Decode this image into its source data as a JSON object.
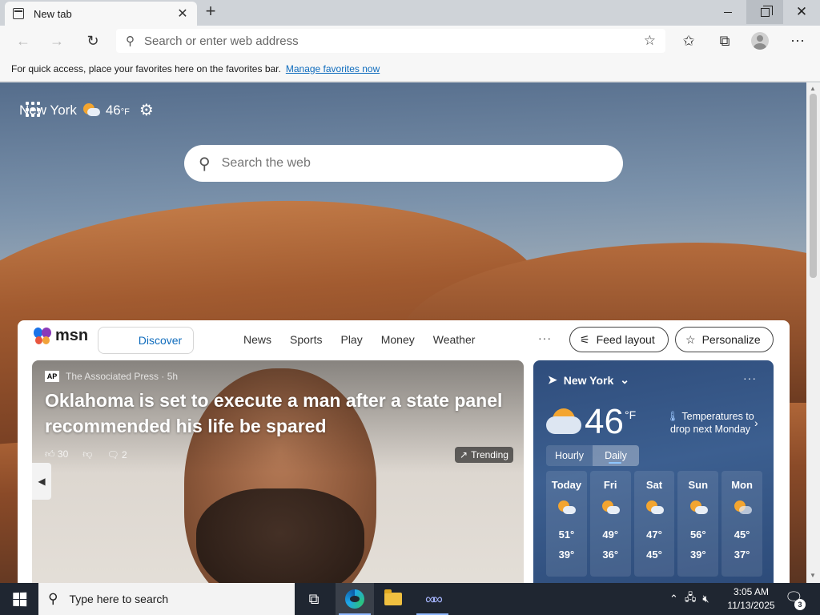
{
  "browser": {
    "tab_title": "New tab",
    "address_placeholder": "Search or enter web address",
    "favorites_bar_text": "For quick access, place your favorites here on the favorites bar.",
    "favorites_bar_link": "Manage favorites now"
  },
  "newtab": {
    "location": "New York",
    "temperature": "46",
    "temp_unit": "°F",
    "search_placeholder": "Search the web"
  },
  "feed": {
    "logo_text": "msn",
    "discover_label": "Discover",
    "nav": [
      "News",
      "Sports",
      "Play",
      "Money",
      "Weather"
    ],
    "more_label": "···",
    "feed_layout_label": "Feed layout",
    "personalize_label": "Personalize"
  },
  "story": {
    "source_badge": "AP",
    "source": "The Associated Press · 5h",
    "headline": "Oklahoma is set to execute a man after a state panel recommended his life be spared",
    "likes": "30",
    "comments": "2",
    "trending_label": "Trending"
  },
  "weather_card": {
    "location": "New York",
    "temperature": "46",
    "unit": "°F",
    "alert": "Temperatures to drop next Monday",
    "tabs": [
      "Hourly",
      "Daily"
    ],
    "active_tab": "Daily",
    "days": [
      {
        "name": "Today",
        "hi": "51°",
        "lo": "39°"
      },
      {
        "name": "Fri",
        "hi": "49°",
        "lo": "36°"
      },
      {
        "name": "Sat",
        "hi": "47°",
        "lo": "45°"
      },
      {
        "name": "Sun",
        "hi": "56°",
        "lo": "39°"
      },
      {
        "name": "Mon",
        "hi": "45°",
        "lo": "37°"
      }
    ]
  },
  "taskbar": {
    "search_placeholder": "Type here to search",
    "time": "3:05 AM",
    "date": "11/13/2025",
    "notification_count": "3"
  },
  "colors": {
    "accent": "#0f6cbd",
    "taskbar": "#1f2631",
    "weather_card": "#3c5f90"
  }
}
